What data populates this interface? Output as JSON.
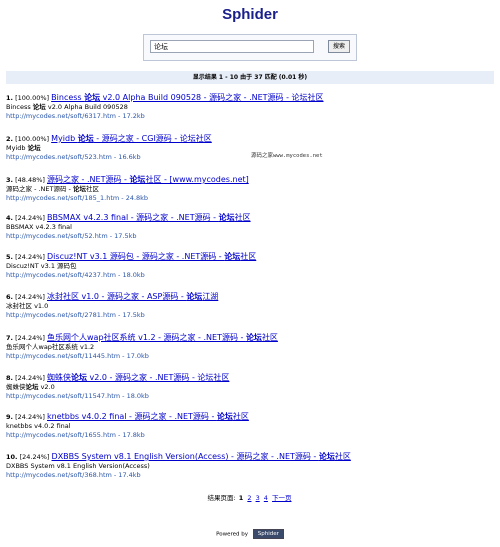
{
  "app": {
    "title": "Sphider"
  },
  "search": {
    "value": "论坛",
    "button_label": "搜索"
  },
  "summary": {
    "text": "显示结果 1 - 10 由于 37 匹配 (0.01 秒)"
  },
  "results": [
    {
      "num": "1.",
      "rel": "[100.00%]",
      "link_pre": "Bincess ",
      "link_bold": "论坛",
      "link_post": " v2.0 Alpha Build 090528 - 源码之家 - .NET源码 - 论坛社区",
      "desc_pre": "Bincess ",
      "desc_bold": "论坛",
      "desc_post": " v2.0 Alpha Build 090528",
      "url": "http://mycodes.net/soft/6317.htm - 17.2kb"
    },
    {
      "num": "2.",
      "rel": "[100.00%]",
      "link_pre": "Myidb ",
      "link_bold": "论坛",
      "link_post": " - 源码之家 - CGI源码 - 论坛社区",
      "desc_pre": "Myidb ",
      "desc_bold": "论坛",
      "desc_post": "",
      "url": "http://mycodes.net/soft/523.htm - 16.6kb"
    },
    {
      "num": "3.",
      "rel": "[48.48%]",
      "link_pre": "源码之家 - .NET源码 - ",
      "link_bold": "论坛",
      "link_post": "社区 - [www.mycodes.net]",
      "desc_pre": "源码之家 - .NET源码 - ",
      "desc_bold": "论坛",
      "desc_post": "社区",
      "url": "http://mycodes.net/soft/185_1.htm - 24.8kb"
    },
    {
      "num": "4.",
      "rel": "[24.24%]",
      "link_pre": "BBSMAX v4.2.3 final - 源码之家 - .NET源码 - ",
      "link_bold": "论坛",
      "link_post": "社区",
      "desc_pre": "BBSMAX v4.2.3 final",
      "desc_bold": "",
      "desc_post": "",
      "url": "http://mycodes.net/soft/52.htm - 17.5kb"
    },
    {
      "num": "5.",
      "rel": "[24.24%]",
      "link_pre": "Discuz!NT v3.1 源码包 - 源码之家 - .NET源码 - ",
      "link_bold": "论坛",
      "link_post": "社区",
      "desc_pre": "Discuz!NT v3.1 源码包",
      "desc_bold": "",
      "desc_post": "",
      "url": "http://mycodes.net/soft/4237.htm - 18.0kb"
    },
    {
      "num": "6.",
      "rel": "[24.24%]",
      "link_pre": "冰封社区 v1.0 - 源码之家 - ASP源码 - ",
      "link_bold": "论坛",
      "link_post": "江湖",
      "desc_pre": "冰封社区 v1.0",
      "desc_bold": "",
      "desc_post": "",
      "url": "http://mycodes.net/soft/2781.htm - 17.5kb"
    },
    {
      "num": "7.",
      "rel": "[24.24%]",
      "link_pre": "鱼乐网个人wap社区系统 v1.2 - 源码之家 - .NET源码 - ",
      "link_bold": "论坛",
      "link_post": "社区",
      "desc_pre": "鱼乐网个人wap社区系统 v1.2",
      "desc_bold": "",
      "desc_post": "",
      "url": "http://mycodes.net/soft/11445.htm - 17.0kb"
    },
    {
      "num": "8.",
      "rel": "[24.24%]",
      "link_pre": "蜘蛛侠",
      "link_bold": "论坛",
      "link_post": " v2.0 - 源码之家 - .NET源码 - 论坛社区",
      "desc_pre": "蜘蛛侠",
      "desc_bold": "论坛",
      "desc_post": " v2.0",
      "url": "http://mycodes.net/soft/11547.htm - 18.0kb"
    },
    {
      "num": "9.",
      "rel": "[24.24%]",
      "link_pre": "knetbbs v4.0.2 final - 源码之家 - .NET源码 - ",
      "link_bold": "论坛",
      "link_post": "社区",
      "desc_pre": "knetbbs v4.0.2 final",
      "desc_bold": "",
      "desc_post": "",
      "url": "http://mycodes.net/soft/1655.htm - 17.8kb"
    },
    {
      "num": "10.",
      "rel": "[24.24%]",
      "link_pre": "DXBBS System v8.1 English Version(Access) - 源码之家 - .NET源码 - ",
      "link_bold": "论坛",
      "link_post": "社区",
      "desc_pre": "DXBBS System v8.1 English Version(Access)",
      "desc_bold": "",
      "desc_post": "",
      "url": "http://mycodes.net/soft/368.htm - 17.4kb"
    }
  ],
  "watermark": {
    "text": "源码之家www.mycodes.net"
  },
  "pager": {
    "label": "结果页面:",
    "current": "1",
    "pages": [
      "2",
      "3",
      "4"
    ],
    "next_label": "下一页"
  },
  "footer": {
    "powered_by": "Powered by",
    "logo_text": "Sphider"
  }
}
